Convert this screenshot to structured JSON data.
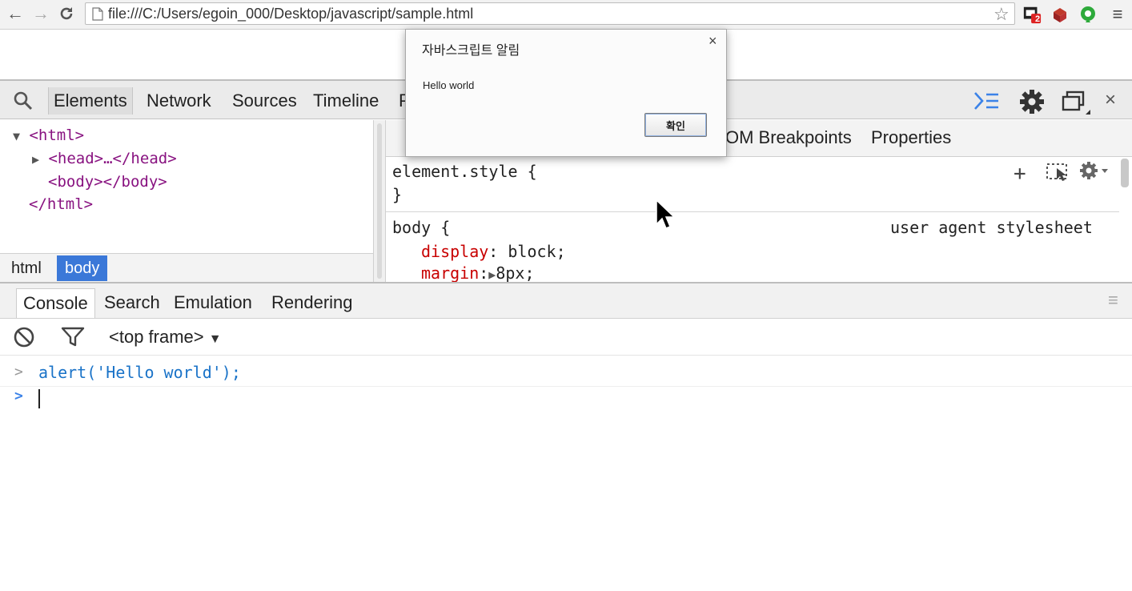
{
  "browser": {
    "url": "file:///C:/Users/egoin_000/Desktop/javascript/sample.html",
    "extension_badge": "2",
    "icons": [
      "back-arrow-icon",
      "forward-arrow-icon",
      "reload-icon",
      "page-icon",
      "star-icon",
      "extension-badge-icon",
      "extension-box-icon",
      "extension-evernote-icon",
      "menu-icon"
    ]
  },
  "devtools": {
    "tabs": [
      "Elements",
      "Network",
      "Sources",
      "Timeline",
      "P"
    ],
    "tree": {
      "html_open": "<html>",
      "head": "<head>…</head>",
      "body": "<body></body>",
      "html_close": "</html>"
    },
    "breadcrumbs": [
      "html",
      "body"
    ],
    "side_tabs": [
      "OM Breakpoints",
      "Properties"
    ],
    "styles": {
      "element_style_selector": "element.style {",
      "element_style_close": "}",
      "body_selector": "body {",
      "body_source": "user agent stylesheet",
      "props": [
        {
          "name": "display",
          "sep": ": ",
          "value": "block;"
        },
        {
          "name": "margin",
          "sep": ":",
          "value": "8px;"
        }
      ]
    }
  },
  "drawer": {
    "tabs": [
      "Console",
      "Search",
      "Emulation",
      "Rendering"
    ],
    "frame_selector": "<top frame>",
    "console_lines": [
      {
        "prompt": ">",
        "text": "alert('Hello world');"
      }
    ],
    "input_prompt": ">"
  },
  "dialog": {
    "title": "자바스크립트 알림",
    "message": "Hello world",
    "ok_label": "확인",
    "close_label": "×"
  },
  "colors": {
    "tag": "#881280",
    "css_prop": "#c80000",
    "console_code": "#1a73c8",
    "selected_crumb": "#3b78d8",
    "drawer_icon": "#3b82e8"
  }
}
